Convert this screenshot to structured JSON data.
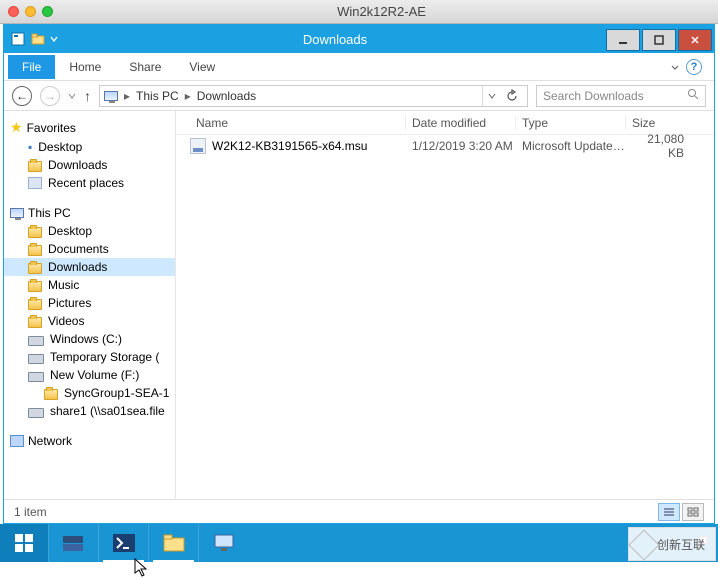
{
  "host": {
    "title": "Win2k12R2-AE"
  },
  "window": {
    "title": "Downloads",
    "ribbon": {
      "file": "File",
      "home": "Home",
      "share": "Share",
      "view": "View"
    },
    "address": {
      "root": "This PC",
      "folder": "Downloads"
    },
    "search": {
      "placeholder": "Search Downloads"
    },
    "columns": {
      "name": "Name",
      "date": "Date modified",
      "type": "Type",
      "size": "Size"
    },
    "files": [
      {
        "name": "W2K12-KB3191565-x64.msu",
        "date": "1/12/2019 3:20 AM",
        "type": "Microsoft Update ...",
        "size": "21,080 KB"
      }
    ],
    "status": "1 item"
  },
  "nav": {
    "favorites": "Favorites",
    "fav_items": [
      "Desktop",
      "Downloads",
      "Recent places"
    ],
    "thispc": "This PC",
    "pc_items": [
      "Desktop",
      "Documents",
      "Downloads",
      "Music",
      "Pictures",
      "Videos",
      "Windows (C:)",
      "Temporary Storage (",
      "New Volume (F:)"
    ],
    "pc_sub": "SyncGroup1-SEA-1",
    "pc_share": "share1 (\\\\sa01sea.file",
    "network": "Network"
  },
  "watermark": "创新互联"
}
